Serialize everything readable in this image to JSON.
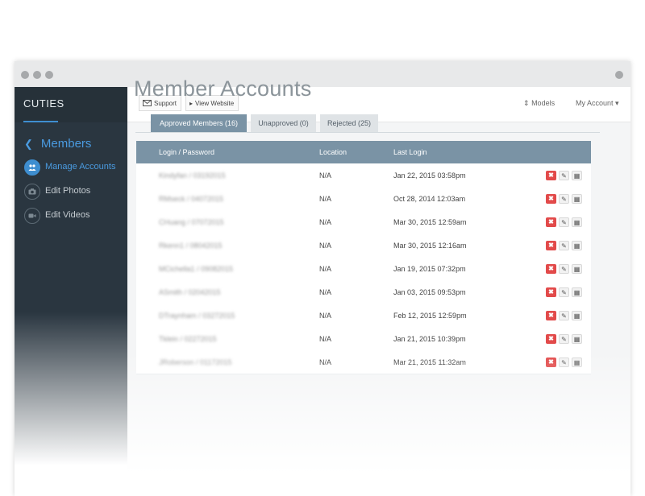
{
  "sidebar": {
    "brand": "CUTIES",
    "section_title": "Members",
    "items": [
      {
        "label": "Manage Accounts",
        "icon": "users-icon",
        "active": true
      },
      {
        "label": "Edit Photos",
        "icon": "camera-icon",
        "active": false
      },
      {
        "label": "Edit Videos",
        "icon": "video-icon",
        "active": false
      }
    ]
  },
  "topbar": {
    "support_label": "Support",
    "view_website_label": "View Website",
    "models_label": "Models",
    "account_label": "My Account"
  },
  "page": {
    "title": "Member Accounts"
  },
  "tabs": [
    {
      "label": "Approved Members (16)",
      "active": true
    },
    {
      "label": "Unapproved (0)",
      "active": false
    },
    {
      "label": "Rejected (25)",
      "active": false
    }
  ],
  "table": {
    "headers": [
      "Login / Password",
      "Location",
      "Last Login"
    ],
    "rows": [
      {
        "login": "Kindyfan / 03192015",
        "location": "N/A",
        "last_login": "Jan 22, 2015 03:58pm"
      },
      {
        "login": "RMseck / 04072015",
        "location": "N/A",
        "last_login": "Oct 28, 2014 12:03am"
      },
      {
        "login": "CHuang / 07072015",
        "location": "N/A",
        "last_login": "Mar 30, 2015 12:59am"
      },
      {
        "login": "Rkenn1 / 08042015",
        "location": "N/A",
        "last_login": "Mar 30, 2015 12:16am"
      },
      {
        "login": "MCichella1 / 09082015",
        "location": "N/A",
        "last_login": "Jan 19, 2015 07:32pm"
      },
      {
        "login": "ASmith / 02042015",
        "location": "N/A",
        "last_login": "Jan 03, 2015 09:53pm"
      },
      {
        "login": "DTraynham / 03272015",
        "location": "N/A",
        "last_login": "Feb 12, 2015 12:59pm"
      },
      {
        "login": "Tklein / 02272015",
        "location": "N/A",
        "last_login": "Jan 21, 2015 10:39pm"
      },
      {
        "login": "JRoberson / 01172015",
        "location": "N/A",
        "last_login": "Mar 21, 2015 11:32am"
      }
    ]
  },
  "colors": {
    "sidebar_bg": "#2a3640",
    "accent": "#3e8ed0",
    "table_header": "#7a93a5",
    "delete_red": "#e24a4a"
  }
}
